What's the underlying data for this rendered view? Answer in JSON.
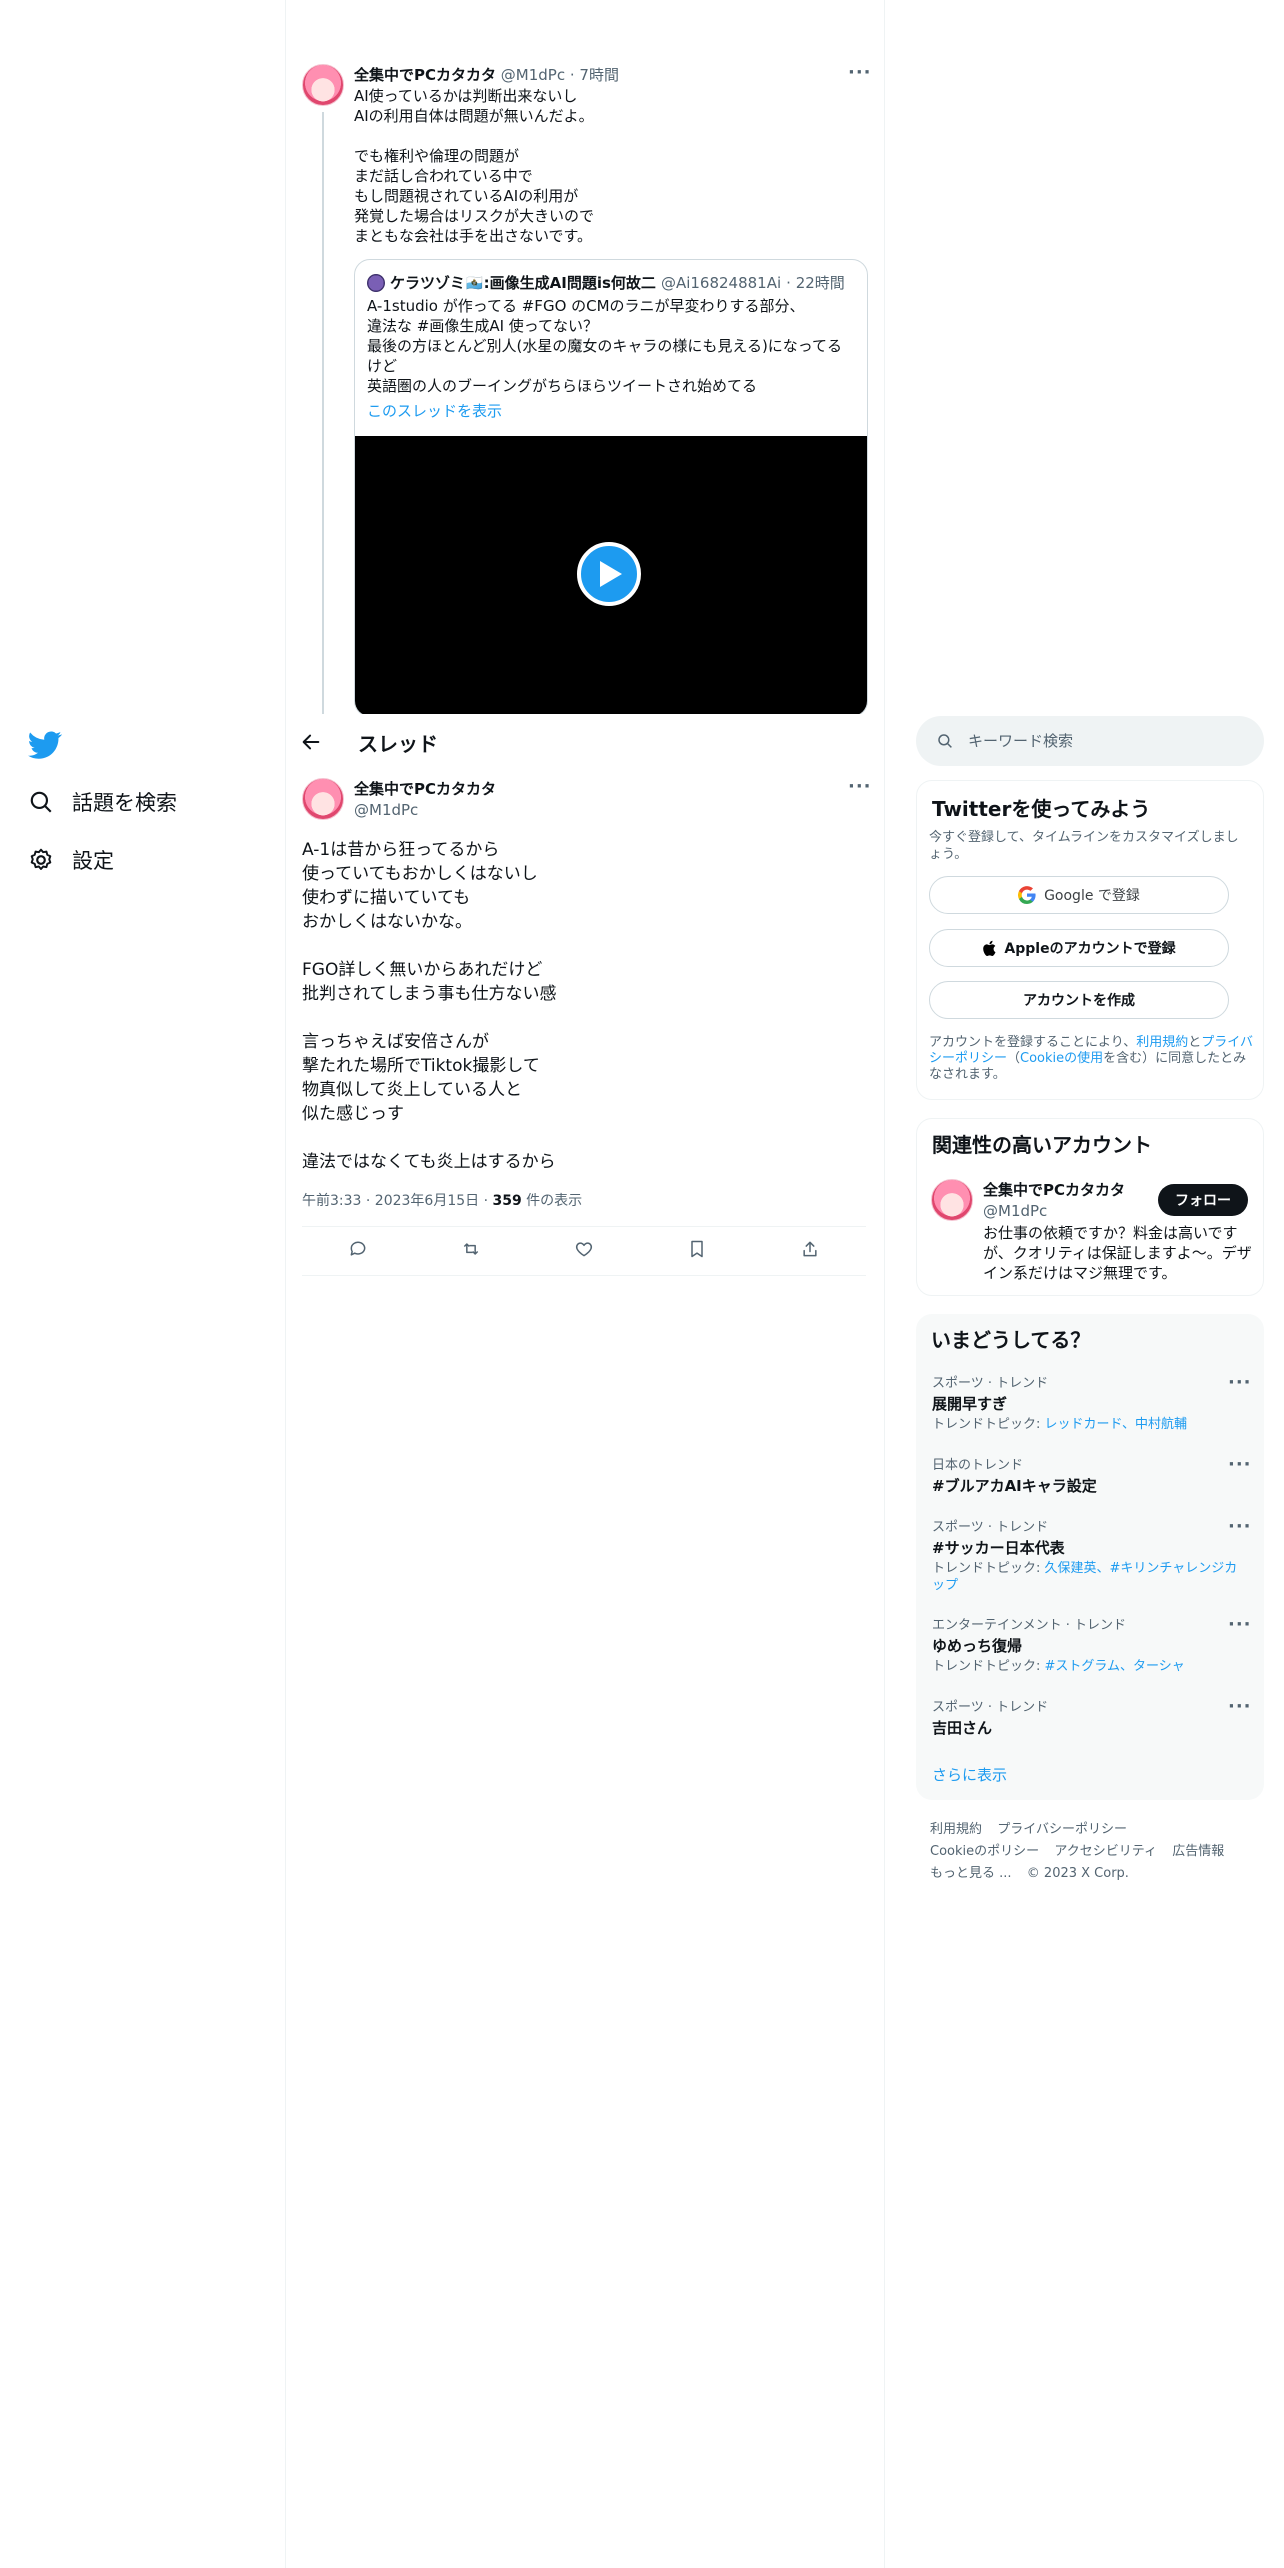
{
  "nav": {
    "explore": "話題を検索",
    "settings": "設定"
  },
  "header": {
    "title": "スレッド"
  },
  "parent_tweet": {
    "name": "全集中でPCカタカタ",
    "handle": "@M1dPc",
    "time": "· 7時間",
    "text": "AI使っているかは判断出来ないし\nAIの利用自体は問題が無いんだよ。\n\nでも権利や倫理の問題が\nまだ話し合われている中で\nもし問題視されているAIの利用が\n発覚した場合はリスクが大きいので\nまともな会社は手を出さないです。",
    "quote": {
      "name": "ケラツゾミ🇸🇲:画像生成AI問題is何故二",
      "handle": "@Ai16824881Ai",
      "time": "· 22時間",
      "text": "A-1studio が作ってる #FGO のCMのラニが早変わりする部分、\n違法な #画像生成AI 使ってない？\n最後の方ほとんど別人(水星の魔女のキャラの様にも見える)になってるけど\n英語圏の人のブーイングがちらほらツイートされ始めてる",
      "show_thread": "このスレッドを表示"
    }
  },
  "main_tweet": {
    "name": "全集中でPCカタカタ",
    "handle": "@M1dPc",
    "text": "A-1は昔から狂ってるから\n使っていてもおかしくはないし\n使わずに描いていても\nおかしくはないかな。\n\nFGO詳しく無いからあれだけど\n批判されてしまう事も仕方ない感\n\n言っちゃえば安倍さんが\n撃たれた場所でTiktok撮影して\n物真似して炎上している人と\n似た感じっす\n\n違法ではなくても炎上はするから",
    "meta_time": "午前3:33 · 2023年6月15日 · ",
    "views_count": "359",
    "views_label": " 件の表示"
  },
  "search": {
    "placeholder": "キーワード検索"
  },
  "signup": {
    "title": "Twitterを使ってみよう",
    "subtitle": "今すぐ登録して、タイムラインをカスタマイズしましょう。",
    "google": "Google で登録",
    "apple": "Appleのアカウントで登録",
    "create": "アカウントを作成",
    "legal_1": "アカウントを登録することにより、",
    "legal_terms": "利用規約",
    "legal_2": "と",
    "legal_privacy": "プライバシーポリシー",
    "legal_3": "（",
    "legal_cookie": "Cookieの使用",
    "legal_4": "を含む）に同意したとみなされます。"
  },
  "related": {
    "title": "関連性の高いアカウント",
    "name": "全集中でPCカタカタ",
    "handle": "@M1dPc",
    "bio": "お仕事の依頼ですか？料金は高いですが、クオリティは保証しますよ〜。デザイン系だけはマジ無理です。",
    "follow": "フォロー"
  },
  "trends": {
    "title": "いまどうしてる？",
    "items": [
      {
        "context": "スポーツ · トレンド",
        "name": "展開早すぎ",
        "topics_label": "トレンドトピック: ",
        "topics": "レッドカード、中村航輔"
      },
      {
        "context": "日本のトレンド",
        "name": "#ブルアカAIキャラ設定",
        "topics_label": "",
        "topics": ""
      },
      {
        "context": "スポーツ · トレンド",
        "name": "#サッカー日本代表",
        "topics_label": "トレンドトピック: ",
        "topics": "久保建英、#キリンチャレンジカップ"
      },
      {
        "context": "エンターテインメント · トレンド",
        "name": "ゆめっち復帰",
        "topics_label": "トレンドトピック: ",
        "topics": "#ストグラム、ターシャ"
      },
      {
        "context": "スポーツ · トレンド",
        "name": "吉田さん",
        "topics_label": "",
        "topics": ""
      }
    ],
    "show_more": "さらに表示"
  },
  "footer": {
    "terms": "利用規約",
    "privacy": "プライバシーポリシー",
    "cookie": "Cookieのポリシー",
    "accessibility": "アクセシビリティ",
    "ads": "広告情報",
    "more": "もっと見る ...",
    "copyright": "© 2023 X Corp."
  },
  "colors": {
    "accent": "#1d9bf0",
    "text": "#0f1419",
    "muted": "#536471"
  }
}
